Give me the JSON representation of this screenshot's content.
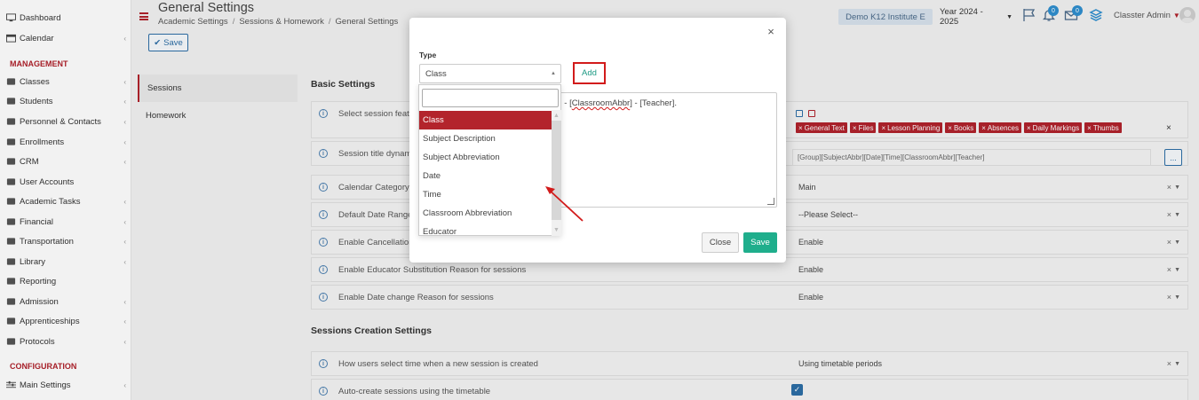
{
  "sidebar": {
    "items_top": [
      {
        "label": "Dashboard",
        "icon": "monitor-icon",
        "chevron": false
      },
      {
        "label": "Calendar",
        "icon": "calendar-icon",
        "chevron": true
      }
    ],
    "management_heading": "MANAGEMENT",
    "management": [
      {
        "label": "Classes",
        "icon": "classes-icon",
        "chevron": true
      },
      {
        "label": "Students",
        "icon": "students-icon",
        "chevron": true
      },
      {
        "label": "Personnel & Contacts",
        "icon": "personnel-icon",
        "chevron": true
      },
      {
        "label": "Enrollments",
        "icon": "enrollments-icon",
        "chevron": true
      },
      {
        "label": "CRM",
        "icon": "crm-icon",
        "chevron": true
      },
      {
        "label": "User Accounts",
        "icon": "key-icon",
        "chevron": false
      },
      {
        "label": "Academic Tasks",
        "icon": "tasks-icon",
        "chevron": true
      },
      {
        "label": "Financial",
        "icon": "financial-icon",
        "chevron": true
      },
      {
        "label": "Transportation",
        "icon": "bus-icon",
        "chevron": true
      },
      {
        "label": "Library",
        "icon": "library-icon",
        "chevron": true
      },
      {
        "label": "Reporting",
        "icon": "printer-icon",
        "chevron": false
      },
      {
        "label": "Admission",
        "icon": "admission-icon",
        "chevron": true
      },
      {
        "label": "Apprenticeships",
        "icon": "apprenticeships-icon",
        "chevron": true
      },
      {
        "label": "Protocols",
        "icon": "protocols-icon",
        "chevron": true
      }
    ],
    "configuration_heading": "CONFIGURATION",
    "configuration": [
      {
        "label": "Main Settings",
        "icon": "settings-icon",
        "chevron": true
      }
    ]
  },
  "header": {
    "title": "General Settings",
    "breadcrumbs": [
      "Academic Settings",
      "Sessions & Homework",
      "General Settings"
    ],
    "institute": "Demo K12 Institute E",
    "year": "Year 2024 - 2025",
    "notif_count": "0",
    "mail_count": "0",
    "user": "Classter Admin"
  },
  "toolbar": {
    "save_label": "Save"
  },
  "subnav": [
    "Sessions",
    "Homework"
  ],
  "basic_settings": {
    "title": "Basic Settings",
    "rows": [
      {
        "label": "Select session featu",
        "value": ""
      },
      {
        "label": "Session title dynam",
        "value": "[Group][SubjectAbbr][Date][Time][ClassroomAbbr][Teacher]"
      },
      {
        "label": "Calendar Category f",
        "value": "Main"
      },
      {
        "label": "Default Date Range",
        "value": "--Please Select--"
      },
      {
        "label": "Enable Cancellation",
        "value": "Enable"
      },
      {
        "label": "Enable Educator Substitution Reason for sessions",
        "value": "Enable"
      },
      {
        "label": "Enable Date change Reason for sessions",
        "value": "Enable"
      }
    ],
    "tags": [
      "General Text",
      "Files",
      "Lesson Planning",
      "Books",
      "Absences",
      "Daily Markings",
      "Thumbs"
    ]
  },
  "creation_settings": {
    "title": "Sessions Creation Settings",
    "rows": [
      {
        "label": "How users select time when a new session is created",
        "value": "Using timetable periods"
      },
      {
        "label": "Auto-create sessions using the timetable",
        "value": ""
      }
    ]
  },
  "modal": {
    "type_label": "Type",
    "select_value": "Class",
    "add_label": "Add",
    "textarea_prefix": "] - [",
    "textarea_underlined": "ClassroomAbbr",
    "textarea_suffix": "] - [Teacher].",
    "close_label": "Close",
    "save_label": "Save",
    "options": [
      "Class",
      "Subject Description",
      "Subject Abbreviation",
      "Date",
      "Time",
      "Classroom Abbreviation",
      "Educator"
    ],
    "selected_index": 0
  },
  "colors": {
    "accent": "#b0222c",
    "primary": "#2d6ea6",
    "save": "#1fae8c",
    "highlight": "#d21b1b"
  }
}
